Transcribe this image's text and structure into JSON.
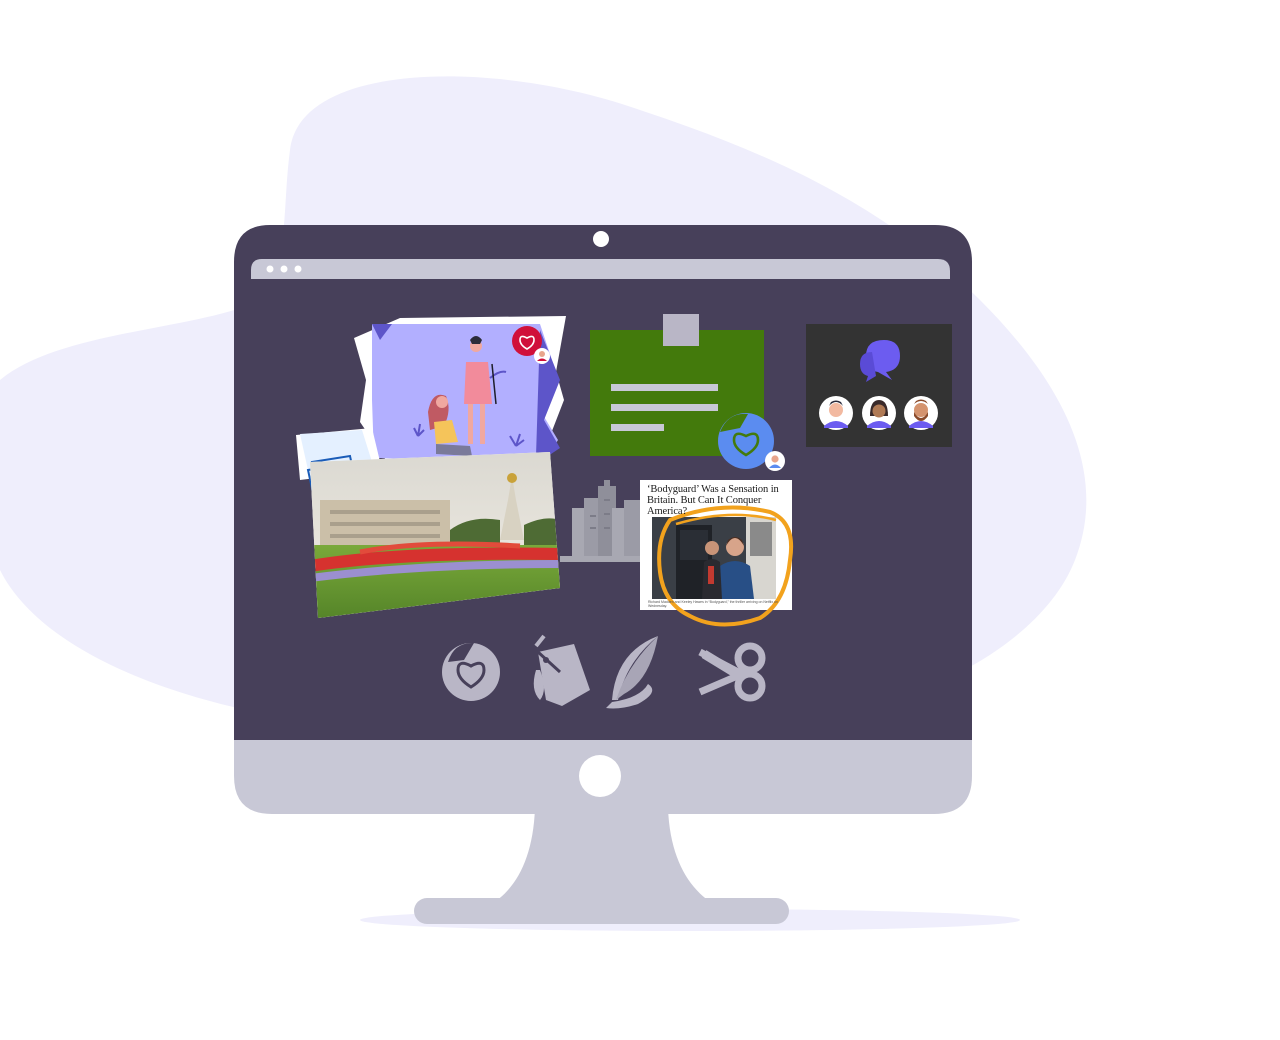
{
  "article": {
    "headline": "‘Bodyguard’ Was a Sensation in Britain. But Can It Conquer America?",
    "caption": "Richard Madden and Keeley Hawes in “Bodyguard,” the thriller arriving on Netflix on Wednesday."
  },
  "colors": {
    "backdrop_blob": "#efeefc",
    "monitor_frame": "#47405a",
    "monitor_chin": "#c8c8d6",
    "toolbar": "#c8c8d6",
    "sticker_blue": "#5b8cf0",
    "sticker_red": "#d0103a",
    "note_green": "#437a0c",
    "chat_panel": "#333333",
    "chat_bubble": "#6c5cf0",
    "annotation_circle": "#f2a21d",
    "tools_icon": "#b9b6c6"
  },
  "icons": [
    "webcam-icon",
    "window-dots-icon",
    "heart-sticker-icon",
    "plane-ticket-icon",
    "city-buildings-icon",
    "chat-bubbles-icon",
    "user-avatar-icon",
    "paint-bucket-icon",
    "quill-pen-icon",
    "scissors-icon"
  ]
}
